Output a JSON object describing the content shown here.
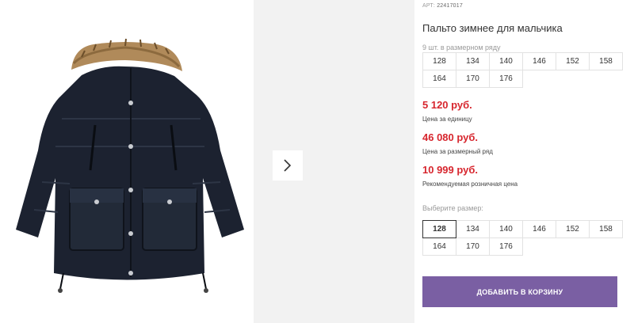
{
  "product": {
    "art_label": "АРТ:",
    "art_value": "22417017",
    "title": "Пальто зимнее для мальчика",
    "pack_note": "9 шт. в размерном ряду",
    "pack_sizes": [
      "128",
      "134",
      "140",
      "146",
      "152",
      "158",
      "164",
      "170",
      "176"
    ],
    "prices": {
      "unit_price": "5 120 руб.",
      "unit_label": "Цена за единицу",
      "pack_price": "46 080 руб.",
      "pack_label": "Цена за размерный ряд",
      "retail_price": "10 999 руб.",
      "retail_label": "Рекомендуемая розничная цена"
    },
    "choose_label": "Выберите размер:",
    "select_sizes": [
      "128",
      "134",
      "140",
      "146",
      "152",
      "158",
      "164",
      "170",
      "176"
    ],
    "selected_size": "128",
    "add_to_cart": "ДОБАВИТЬ В КОРЗИНУ"
  },
  "gallery": {
    "next_icon": "chevron-right-icon"
  },
  "colors": {
    "price": "#d7262e",
    "button": "#7a5fa3",
    "coat": "#1c2230",
    "fur": "#b08a5a"
  }
}
